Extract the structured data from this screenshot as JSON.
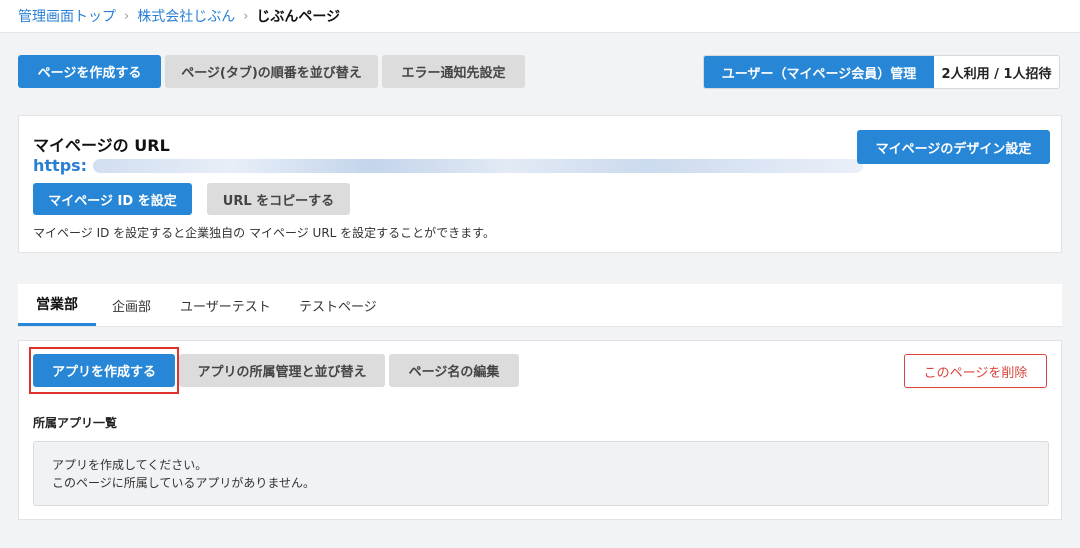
{
  "breadcrumb": {
    "items": [
      "管理画面トップ",
      "株式会社じぶん"
    ],
    "current": "じぶんページ",
    "separator": "›"
  },
  "toolbar": {
    "create_page": "ページを作成する",
    "reorder_tabs": "ページ(タブ)の順番を並び替え",
    "error_notify": "エラー通知先設定"
  },
  "user_management": {
    "button_label": "ユーザー（マイページ会員）管理",
    "status": "2人利用 / 1人招待"
  },
  "mypage_url": {
    "title": "マイページの URL",
    "url_prefix": "https:",
    "design_button": "マイページのデザイン設定",
    "set_id_button": "マイページ ID を設定",
    "copy_url_button": "URL をコピーする",
    "note": "マイページ ID を設定すると企業独自の マイページ URL を設定することができます。"
  },
  "tabs": [
    {
      "label": "営業部",
      "active": true
    },
    {
      "label": "企画部",
      "active": false
    },
    {
      "label": "ユーザーテスト",
      "active": false
    },
    {
      "label": "テストページ",
      "active": false
    }
  ],
  "page_panel": {
    "create_app": "アプリを作成する",
    "manage_apps": "アプリの所属管理と並び替え",
    "edit_name": "ページ名の編集",
    "delete_page": "このページを削除",
    "apps_heading": "所属アプリ一覧",
    "empty_line1": "アプリを作成してください。",
    "empty_line2": "このページに所属しているアプリがありません。"
  },
  "colors": {
    "primary": "#2787d6",
    "link": "#2a7fd4",
    "danger": "#d9443c",
    "highlight": "#e0312c"
  }
}
